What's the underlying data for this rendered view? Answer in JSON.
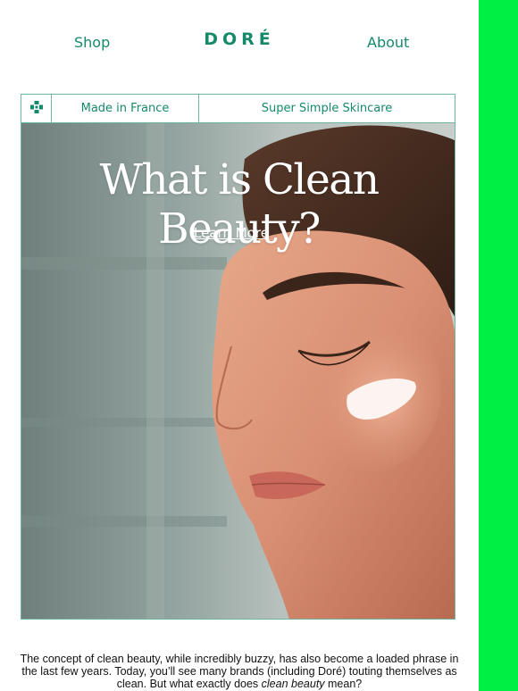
{
  "nav": {
    "shop_label": "Shop",
    "logo_text": "DORÉ",
    "about_label": "About"
  },
  "strip": {
    "icon": "green-cross-icon",
    "made_in": "Made in France",
    "tagline": "Super Simple Skincare"
  },
  "hero": {
    "title": "What is Clean Beauty?",
    "cta_label": "Learn More"
  },
  "intro": {
    "text_part1": "The concept of clean beauty, while incredibly buzzy, has also become a loaded phrase in the last few years. Today, you’ll see many brands (including Doré) touting themselves as clean. But what exactly does ",
    "text_emphasis": "clean beauty",
    "text_part2": " mean?"
  },
  "colors": {
    "brand_green": "#16896a",
    "accent_bar": "#00ef44"
  }
}
